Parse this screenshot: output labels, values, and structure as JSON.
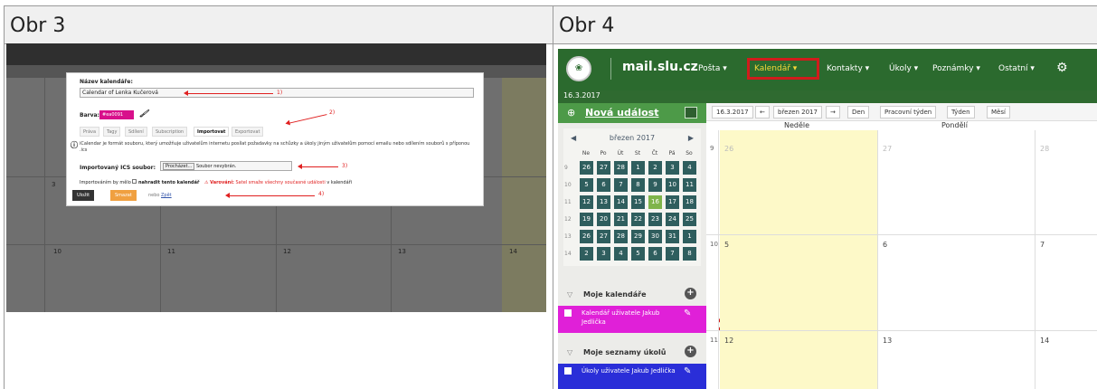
{
  "headers": {
    "left": "Obr 3",
    "right": "Obr 4"
  },
  "obr3": {
    "dialog": {
      "name_label": "Název kalendáře:",
      "name_value": "Calendar of Lenka Kučerová",
      "color_label": "Barva:",
      "color_value": "#ea0091",
      "tabs": [
        "Práva",
        "Tagy",
        "Sdílení",
        "Subscription",
        "Importovat",
        "Exportovat"
      ],
      "active_tab": "Importovat",
      "info_text": "iCalendar je formát souboru, který umožňuje uživatelům internetu posílat požadavky na schůzky a úkoly jiným uživatelům pomocí emailu nebo sdílením souborů s příponou .ics",
      "ics_label": "Importovaný ICS soubor:",
      "browse_button": "Procházet...",
      "no_file": "Soubor nevybrán.",
      "replace_prefix": "Importováním by mělo",
      "replace_bold": "nahradit tento kalendář",
      "warning_prefix": "Varování:",
      "warning_text": "Satel smaže všechny současné události",
      "warning_suffix": "v kalendáři",
      "save_button": "Uložit",
      "delete_button": "Smazat",
      "or_text": "nebo",
      "back_link": "Zpět",
      "annotations": [
        "1)",
        "2)",
        "3)",
        "4)"
      ]
    },
    "grid_numbers": [
      "3",
      "10",
      "11",
      "12",
      "13",
      "14"
    ],
    "accent_colors": {
      "save": "#333333",
      "delete": "#f0a040",
      "arrow": "#e02020",
      "swatch": "#d8108b"
    }
  },
  "obr4": {
    "site": "mail.slu.cz",
    "menu": [
      "Pošta ▾",
      "Kalendář ▾",
      "Kontakty ▾",
      "Úkoly ▾",
      "Poznámky ▾",
      "Ostatní ▾"
    ],
    "highlighted_menu": "Kalendář ▾",
    "date": "16.3.2017",
    "new_event": "Nová událost",
    "mini_calendar": {
      "month": "březen 2017",
      "dow": [
        "Ne",
        "Po",
        "Út",
        "St",
        "Čt",
        "Pá",
        "So"
      ],
      "weeks": [
        {
          "wk": "9",
          "days": [
            "26",
            "27",
            "28",
            "1",
            "2",
            "3",
            "4"
          ]
        },
        {
          "wk": "10",
          "days": [
            "5",
            "6",
            "7",
            "8",
            "9",
            "10",
            "11"
          ]
        },
        {
          "wk": "11",
          "days": [
            "12",
            "13",
            "14",
            "15",
            "16",
            "17",
            "18"
          ]
        },
        {
          "wk": "12",
          "days": [
            "19",
            "20",
            "21",
            "22",
            "23",
            "24",
            "25"
          ]
        },
        {
          "wk": "13",
          "days": [
            "26",
            "27",
            "28",
            "29",
            "30",
            "31",
            "1"
          ]
        },
        {
          "wk": "14",
          "days": [
            "2",
            "3",
            "4",
            "5",
            "6",
            "7",
            "8"
          ]
        }
      ],
      "today": "16"
    },
    "my_calendars": "Moje kalendáře",
    "calendar_item": "Kalendář uživatele Jakub Jedlička",
    "my_tasklists": "Moje seznamy úkolů",
    "tasklist_item": "Úkoly uživatele Jakub Jedlička",
    "toolbar": {
      "date": "16.3.2017",
      "month": "březen 2017",
      "views": [
        "Den",
        "Pracovní týden",
        "Týden",
        "Měsí"
      ]
    },
    "col_headers": [
      "Neděle",
      "Pondělí"
    ],
    "week_numbers": [
      "9",
      "10",
      "11"
    ],
    "month_days": [
      [
        "26",
        "27",
        "28"
      ],
      [
        "5",
        "6",
        "7"
      ],
      [
        "12",
        "13",
        "14"
      ]
    ],
    "colors": {
      "nav": "#2b6a2e",
      "highlight": "#d01c1c",
      "calendar_item": "#e020d8",
      "tasklist_item": "#2a2ed8",
      "sunday": "#fdf9c8"
    }
  }
}
